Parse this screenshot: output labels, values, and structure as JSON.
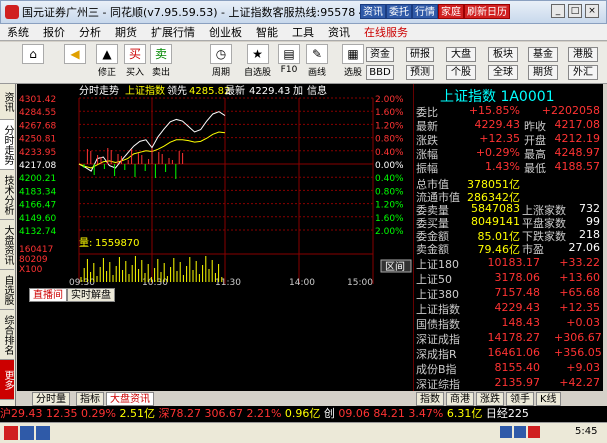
{
  "window": {
    "title": "国元证券广州三 - 同花顺(v7.95.59.53) - 上证指数客服热线:95578 4008888777",
    "buttons": [
      "资讯",
      "委托",
      "行情"
    ],
    "red_buttons": [
      "家庭",
      "刷新日历"
    ],
    "controls": [
      "_",
      "□",
      "×"
    ]
  },
  "menu": [
    "系统",
    "报价",
    "分析",
    "期货",
    "扩展行情",
    "创业板",
    "智能",
    "工具",
    "资讯",
    "在线服务"
  ],
  "toolbar": {
    "buttons": [
      "修正",
      "买入",
      "卖出",
      "周期",
      "自选股",
      "F10",
      "画线",
      "选股"
    ],
    "buy_glyph": "买",
    "sell_glyph": "卖",
    "right_top": [
      "资金",
      "研报",
      "大盘",
      "板块",
      "基金",
      "港股"
    ],
    "right_bottom": [
      "BBD",
      "预测",
      "个股",
      "全球",
      "期货",
      "外汇"
    ]
  },
  "sidebar": [
    "资讯",
    "分时走势",
    "技术分析",
    "大盘资讯",
    "自选股",
    "综合排名",
    "更多"
  ],
  "chart": {
    "label": "分时走势",
    "index_name": "上证指数",
    "lead_label": "领先",
    "lead_value": "4285.82",
    "latest_label": "最新",
    "latest_value": "4229.43",
    "add_label": "加",
    "info_label": "信息",
    "left_ticks": [
      "4301.42",
      "4284.55",
      "4267.68",
      "4250.81",
      "4233.95",
      "4217.08",
      "4200.21",
      "4183.34",
      "4166.47",
      "4149.60",
      "4132.74"
    ],
    "right_ticks": [
      "2.00%",
      "1.60%",
      "1.20%",
      "0.80%",
      "0.40%",
      "0.00%",
      "0.40%",
      "0.80%",
      "1.20%",
      "1.60%",
      "2.00%"
    ],
    "vol_label": "量:",
    "vol_value": "1559870",
    "vol_ticks": [
      "160417",
      "80209",
      "X100"
    ],
    "time_ticks": [
      "09:30",
      "10:30",
      "11:30",
      "14:00",
      "15:00"
    ],
    "zoom_btn": "区间"
  },
  "chart_data": {
    "type": "line",
    "title": "分时走势",
    "categories": [
      "09:30",
      "10:30",
      "11:30",
      "14:00",
      "15:00"
    ],
    "series": [
      {
        "name": "上证指数",
        "values": [
          4217.08,
          4260.5,
          4250.0,
          4229.43
        ]
      }
    ],
    "ylim": [
      4132.74,
      4301.42
    ]
  },
  "lower_tabs": [
    "直播间",
    "实时解盘"
  ],
  "right": {
    "title": "上证指数 1A0001",
    "rows": [
      {
        "a": "委比",
        "b": "+15.85%",
        "c": "+2202058"
      },
      {
        "a": "最新",
        "b": "4229.43",
        "c": "昨收",
        "d": "4217.08"
      },
      {
        "a": "涨跌",
        "b": "+12.35",
        "c": "开盘",
        "d": "4212.19"
      },
      {
        "a": "涨幅",
        "b": "+0.29%",
        "c": "最高",
        "d": "4248.97"
      },
      {
        "a": "振幅",
        "b": "1.43%",
        "c": "最低",
        "d": "4188.57"
      }
    ],
    "rows2": [
      {
        "a": "总市值",
        "b": "378051亿"
      },
      {
        "a": "流通市值",
        "b": "286342亿"
      },
      {
        "a": "委卖量",
        "b": "5847083",
        "c": "上涨家数",
        "d": "732"
      },
      {
        "a": "委买量",
        "b": "8049141",
        "c": "平盘家数",
        "d": "99"
      },
      {
        "a": "委金额",
        "b": "85.01亿",
        "c": "下跌家数",
        "d": "218"
      },
      {
        "a": "卖金额",
        "b": "79.46亿",
        "c": "市盈",
        "d": "27.06"
      }
    ],
    "indices": [
      {
        "n": "上证180",
        "v": "10183.17",
        "c": "+33.22"
      },
      {
        "n": "上证50",
        "v": "3178.06",
        "c": "+13.60"
      },
      {
        "n": "上证380",
        "v": "7157.48",
        "c": "+65.68"
      },
      {
        "n": "上证指数",
        "v": "4229.43",
        "c": "+12.35"
      },
      {
        "n": "国债指数",
        "v": "148.43",
        "c": "+0.03"
      },
      {
        "n": "深证成指",
        "v": "14178.27",
        "c": "+306.67"
      },
      {
        "n": "深成指R",
        "v": "16461.06",
        "c": "+356.05"
      },
      {
        "n": "成份B指",
        "v": "8155.40",
        "c": "+9.03"
      },
      {
        "n": "深证综指",
        "v": "2135.97",
        "c": "+42.27"
      }
    ],
    "bottom_tabs": [
      "指数",
      "商港",
      "涨跌",
      "领手",
      "K线"
    ]
  },
  "bottom_tabs": [
    "分时量",
    "指标",
    "大盘资讯"
  ],
  "status": {
    "sh": "沪29.43",
    "sh2": "12.35",
    "sh3": "0.29%",
    "sh4": "2.51亿",
    "sz": "深78.27",
    "sz2": "306.67",
    "sz3": "2.21%",
    "sz4": "0.96亿",
    "cy": "创",
    "cy2": "09.06",
    "cy3": "84.21",
    "cy4": "3.47%",
    "cy5": "6.31亿",
    "gz": "日经225"
  },
  "clock": "5:45"
}
